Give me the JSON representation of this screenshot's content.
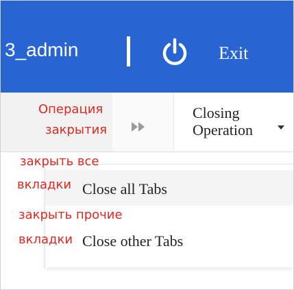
{
  "header": {
    "user": "3_admin",
    "exit_label": "Exit",
    "icons": [
      "power-icon"
    ],
    "color": "#2864d2"
  },
  "tabs": {
    "scroll_icon": "double-chevron-right-icon",
    "dropdown_label": "Closing\nOperation",
    "caret_icon": "caret-down-icon"
  },
  "menu": {
    "items": [
      {
        "label": "Close all Tabs"
      },
      {
        "label": "Close other Tabs"
      }
    ]
  },
  "annotations": {
    "operation_line1": "Операция",
    "operation_line2": "закрытия",
    "close_all_line1": "закрыть все",
    "close_all_line2": "вкладки",
    "close_other_line1": "закрыть прочие",
    "close_other_line2": "вкладки",
    "color": "#e0281e"
  }
}
